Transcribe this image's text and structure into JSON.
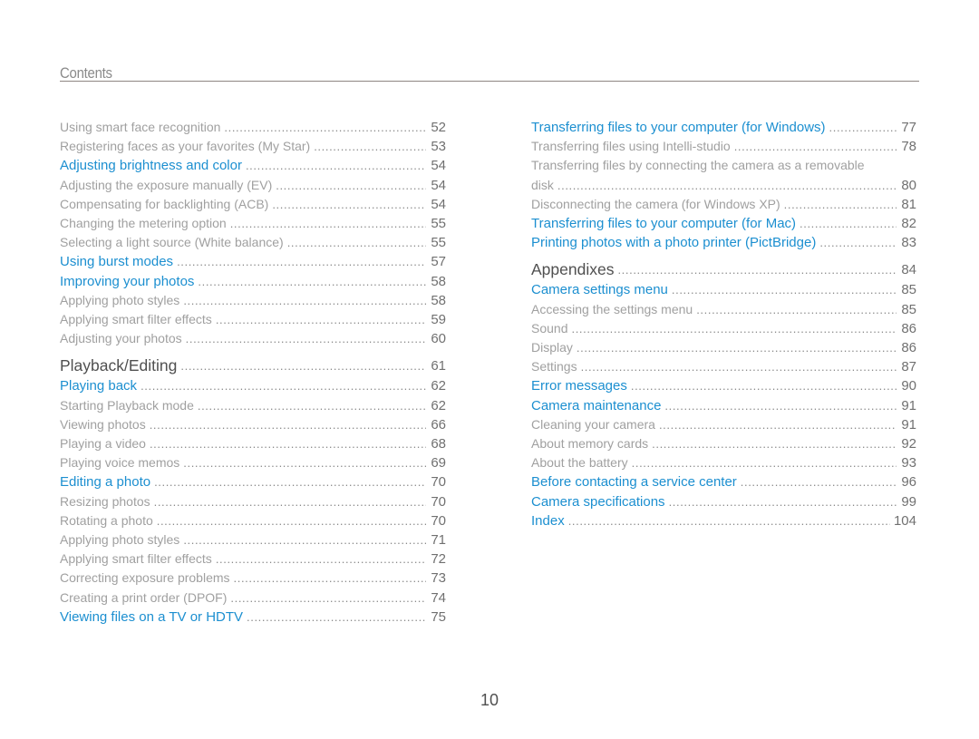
{
  "header": {
    "title": "Contents"
  },
  "colors": {
    "topic": "#1c8fd0",
    "subtopic": "#a0a0a0",
    "chapter": "#505050",
    "rule": "#8e8682"
  },
  "left_column": [
    {
      "level": "sub",
      "label": "Using smart face recognition",
      "page": "52"
    },
    {
      "level": "sub",
      "label": "Registering faces as your favorites (My Star)",
      "page": "53"
    },
    {
      "level": "topic",
      "label": "Adjusting brightness and color",
      "page": "54"
    },
    {
      "level": "sub",
      "label": "Adjusting the exposure manually (EV)",
      "page": "54"
    },
    {
      "level": "sub",
      "label": "Compensating for backlighting (ACB)",
      "page": "54"
    },
    {
      "level": "sub",
      "label": "Changing the metering option",
      "page": "55"
    },
    {
      "level": "sub",
      "label": "Selecting a light source (White balance)",
      "page": "55"
    },
    {
      "level": "topic",
      "label": "Using burst modes",
      "page": "57"
    },
    {
      "level": "topic",
      "label": "Improving your photos",
      "page": "58"
    },
    {
      "level": "sub",
      "label": "Applying photo styles",
      "page": "58"
    },
    {
      "level": "sub",
      "label": "Applying smart filter effects",
      "page": "59"
    },
    {
      "level": "sub",
      "label": "Adjusting your photos",
      "page": "60"
    },
    {
      "level": "chapter",
      "label": "Playback/Editing",
      "page": "61"
    },
    {
      "level": "topic",
      "label": "Playing back",
      "page": "62"
    },
    {
      "level": "sub",
      "label": "Starting Playback mode",
      "page": "62"
    },
    {
      "level": "sub",
      "label": "Viewing photos",
      "page": "66"
    },
    {
      "level": "sub",
      "label": "Playing a video",
      "page": "68"
    },
    {
      "level": "sub",
      "label": "Playing voice memos",
      "page": "69"
    },
    {
      "level": "topic",
      "label": "Editing a photo",
      "page": "70"
    },
    {
      "level": "sub",
      "label": "Resizing photos",
      "page": "70"
    },
    {
      "level": "sub",
      "label": "Rotating a photo",
      "page": "70"
    },
    {
      "level": "sub",
      "label": "Applying photo styles",
      "page": "71"
    },
    {
      "level": "sub",
      "label": "Applying smart filter effects",
      "page": "72"
    },
    {
      "level": "sub",
      "label": "Correcting exposure problems",
      "page": "73"
    },
    {
      "level": "sub",
      "label": "Creating a print order (DPOF)",
      "page": "74"
    },
    {
      "level": "topic",
      "label": "Viewing files on a TV or HDTV",
      "page": "75"
    }
  ],
  "right_column": [
    {
      "level": "topic",
      "label": "Transferring files to your computer (for Windows)",
      "page": "77"
    },
    {
      "level": "sub",
      "label": "Transferring files using Intelli-studio",
      "page": "78"
    },
    {
      "level": "sub-wrap",
      "label": "Transferring files by connecting the camera as a removable",
      "label_line2": "disk",
      "page": "80"
    },
    {
      "level": "sub",
      "label": "Disconnecting the camera (for Windows XP)",
      "page": "81"
    },
    {
      "level": "topic",
      "label": "Transferring files to your computer (for Mac)",
      "page": "82"
    },
    {
      "level": "topic",
      "label": "Printing photos with a photo printer (PictBridge)",
      "page": "83"
    },
    {
      "level": "chapter",
      "label": "Appendixes",
      "page": "84"
    },
    {
      "level": "topic",
      "label": "Camera settings menu",
      "page": "85"
    },
    {
      "level": "sub",
      "label": "Accessing the settings menu",
      "page": "85"
    },
    {
      "level": "sub",
      "label": "Sound",
      "page": "86"
    },
    {
      "level": "sub",
      "label": "Display",
      "page": "86"
    },
    {
      "level": "sub",
      "label": "Settings",
      "page": "87"
    },
    {
      "level": "topic",
      "label": "Error messages",
      "page": "90"
    },
    {
      "level": "topic",
      "label": "Camera maintenance",
      "page": "91"
    },
    {
      "level": "sub",
      "label": "Cleaning your camera",
      "page": "91"
    },
    {
      "level": "sub",
      "label": "About memory cards",
      "page": "92"
    },
    {
      "level": "sub",
      "label": "About the battery",
      "page": "93"
    },
    {
      "level": "topic",
      "label": "Before contacting a service center",
      "page": "96"
    },
    {
      "level": "topic",
      "label": "Camera specifications",
      "page": "99"
    },
    {
      "level": "topic",
      "label": "Index",
      "page": "104"
    }
  ],
  "footer": {
    "page_number": "10"
  }
}
